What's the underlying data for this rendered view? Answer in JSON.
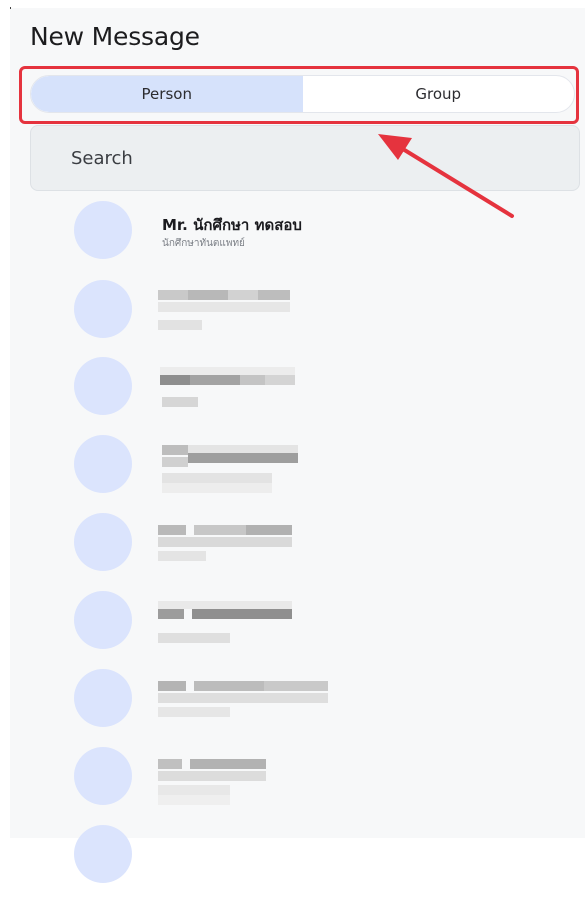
{
  "header": {
    "title": "New Message"
  },
  "tabs": [
    {
      "label": "Person",
      "active": true
    },
    {
      "label": "Group",
      "active": false
    }
  ],
  "search": {
    "placeholder": "Search"
  },
  "contacts": [
    {
      "name": "Mr. นักศึกษา ทดสอบ",
      "subtitle": "นักศึกษาทันตแพทย์"
    }
  ],
  "colors": {
    "accent_tab": "#d6e2fb",
    "avatar": "#dbe4fd",
    "highlight": "#e5333e"
  }
}
